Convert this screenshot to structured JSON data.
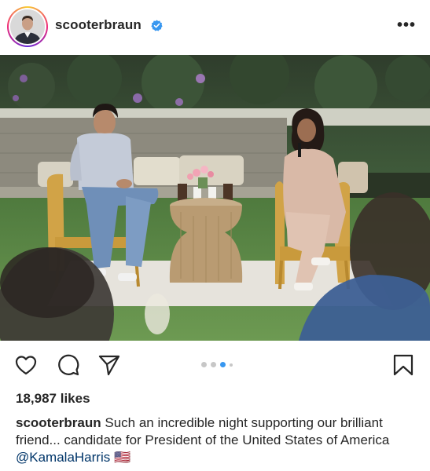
{
  "post": {
    "username": "scooterbraun",
    "verified": true,
    "more_label": "•••",
    "likes": "18,987 likes",
    "caption": {
      "username": "scooterbraun",
      "text": "Such an incredible night supporting our brilliant friend... candidate for President of the United States of America",
      "mention": "@KamalaHarris",
      "emoji": "🇺🇸"
    },
    "carousel": {
      "count": 5,
      "active_index": 2
    }
  },
  "colors": {
    "verified_blue": "#3897f0",
    "text": "#262626",
    "mention": "#003569",
    "dot_inactive": "#c7c7c7",
    "dot_active": "#3897f0"
  },
  "icons": [
    "heart-icon",
    "comment-icon",
    "share-icon",
    "bookmark-icon",
    "more-icon",
    "verified-icon"
  ]
}
